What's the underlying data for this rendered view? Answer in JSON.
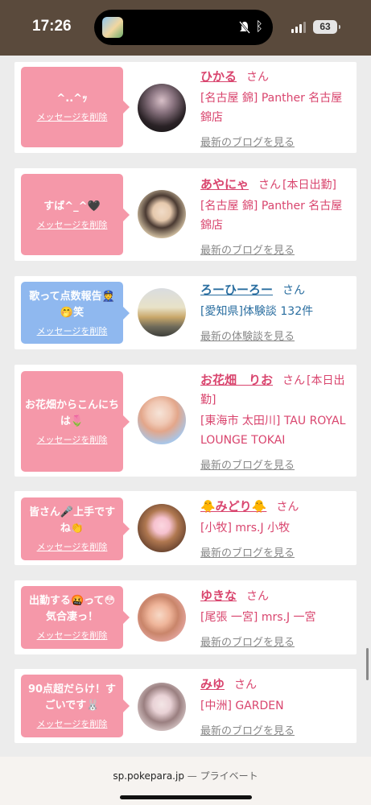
{
  "status": {
    "time": "17:26",
    "battery": "63"
  },
  "delete_label": "メッセージを削除",
  "honorific": "さん",
  "cards": [
    {
      "message": "^..^ｯ",
      "name": "ひかる",
      "tag": "",
      "shop": "[名古屋 錦] Panther 名古屋錦店",
      "link": "最新のブログを見る"
    },
    {
      "message": "すば^_^🖤",
      "name": "あやにゃ",
      "tag": "[本日出勤]",
      "shop": "[名古屋 錦] Panther 名古屋錦店",
      "link": "最新のブログを見る"
    },
    {
      "message": "歌って点数報告👮🤭笑",
      "name": "ろーひーろー",
      "tag": "",
      "shop": "[愛知県]体験談 132件",
      "link": "最新の体験談を見る"
    },
    {
      "message": "お花畑からこんにちは🌷",
      "name": "お花畑　りお",
      "tag": "[本日出勤]",
      "shop": "[東海市 太田川] TAU ROYAL LOUNGE TOKAI",
      "link": "最新のブログを見る"
    },
    {
      "message": "皆さん🎤上手ですね👏",
      "name": "🐥みどり🐥",
      "tag": "",
      "shop": "[小牧] mrs.J 小牧",
      "link": "最新のブログを見る"
    },
    {
      "message": "出勤する🤬って😳気合凄っ！",
      "name": "ゆきな",
      "tag": "",
      "shop": "[尾張 一宮] mrs.J 一宮",
      "link": "最新のブログを見る"
    },
    {
      "message": "90点超だらけ！すごいです🐰",
      "name": "みゆ",
      "tag": "",
      "shop": "[中洲] GARDEN",
      "link": "最新のブログを見る"
    }
  ],
  "browser": {
    "url": "sp.pokepara.jp",
    "separator": "—",
    "mode": "プライベート"
  },
  "colors": {
    "pink": "#f598a9",
    "blue_bubble": "#8fb8ef",
    "name_pink": "#d9456e",
    "name_blue": "#2a6ea0"
  },
  "icons": [
    "app-thumbnail-icon",
    "mute-bell-icon",
    "bluetooth-icon",
    "signal-icon",
    "battery-icon"
  ]
}
